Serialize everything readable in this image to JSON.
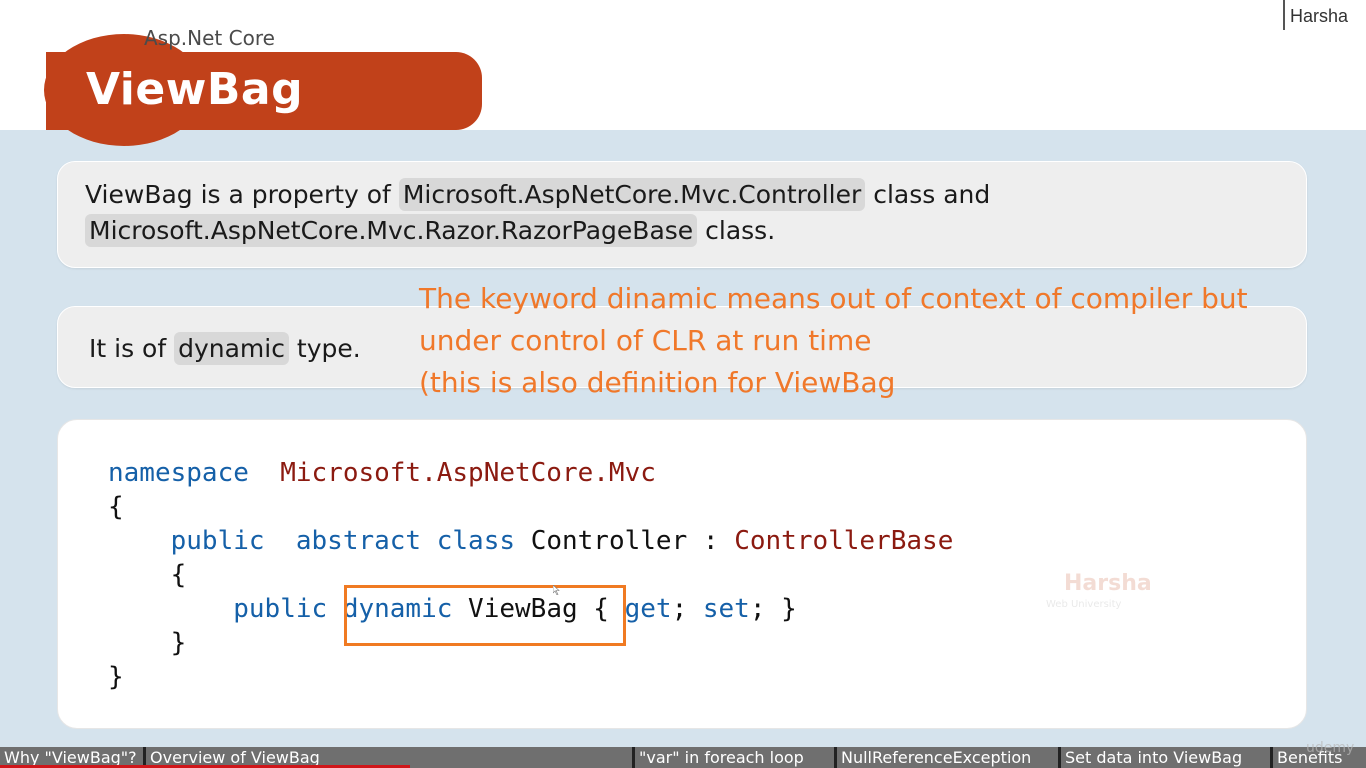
{
  "brand": "Harsha",
  "header": {
    "subtitle": "Asp.Net Core",
    "title": "ViewBag"
  },
  "card1": {
    "p1": "ViewBag is a property of ",
    "code1": "Microsoft.AspNetCore.Mvc.Controller",
    "p2": " class and",
    "code2": "Microsoft.AspNetCore.Mvc.Razor.RazorPageBase",
    "p3": " class."
  },
  "card2": {
    "p1": "It is of ",
    "code": "dynamic",
    "p2": " type."
  },
  "note": {
    "line1": "The keyword dinamic means out of context of compiler but",
    "line2": "under control of CLR at run time",
    "line3": "(this is also definition for ViewBag"
  },
  "code": {
    "ns_kw": "namespace",
    "ns_name": "Microsoft.AspNetCore.Mvc",
    "open_brace": "{",
    "public_kw": "public",
    "abstract_kw": "abstract",
    "class_kw": "class",
    "class_name": "Controller",
    "colon": ":",
    "base": "ControllerBase",
    "inner_open": "{",
    "public_kw2": "public",
    "dynamic_kw": "dynamic",
    "prop_name": "ViewBag",
    "prop_open": "{",
    "get_kw": "get",
    "semi1": ";",
    "set_kw": "set",
    "semi2": ";",
    "prop_close": "}",
    "inner_close": "}",
    "close_brace": "}"
  },
  "watermark": {
    "name": "Harsha",
    "sub": "Web University"
  },
  "chapters": [
    "Why \"ViewBag\"?",
    "Overview of ViewBag",
    "\"var\" in foreach loop",
    "NullReferenceException",
    "Set data into ViewBag",
    "Benefits"
  ],
  "video_progress": 0.3,
  "player_watermark": "udemy",
  "colors": {
    "accent": "#c1411a",
    "note": "#f0782a",
    "keyword": "#1560a8",
    "type": "#8b1a10",
    "highlight_box": "#f07a22",
    "progress": "#d0161a"
  }
}
